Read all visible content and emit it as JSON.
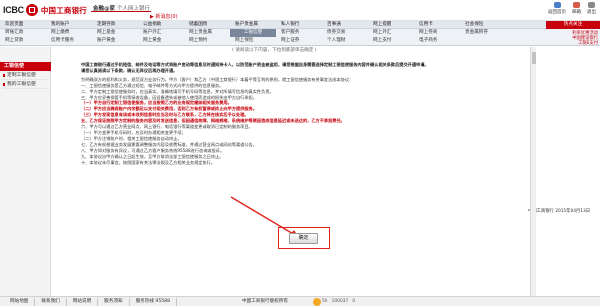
{
  "header": {
    "logo_en": "ICBC",
    "logo_cn": "中国工商银行",
    "product": "金融@家",
    "sub": "个人网上银行",
    "new_msg": "▶ 新消息(0)",
    "top_links": [
      {
        "label": "返回首页",
        "color": "blue"
      },
      {
        "label": "邮箱",
        "color": "red"
      },
      {
        "label": "退出",
        "color": "gray"
      }
    ]
  },
  "nav": {
    "row1": [
      "欢迎页面",
      "我的账户",
      "定期存款",
      "公益捐助",
      "储蓄国债",
      "账户贵金属",
      "私人银行",
      "百事通",
      "网上提醒",
      "信用卡",
      "社会保险"
    ],
    "row2": [
      "转账汇款",
      "网上缴费",
      "网上基金",
      "账户外汇",
      "网上贵金属",
      "网上保险",
      "客户服务",
      "债券交易",
      "网上外汇",
      "网上券商",
      "贵金属积存"
    ],
    "row3": [
      "网上贷款",
      "信用卡服务",
      "账户黄金",
      "网上黄金",
      "网上预约",
      "工银信使",
      "网上证券",
      "个人理财",
      "网上支付",
      "电子商务",
      "网上预约"
    ],
    "active_row2_index": 0,
    "hot_label": "热点关注",
    "hot_lines": [
      "利率优惠活动",
      "中国建设银行",
      "工银E支付"
    ]
  },
  "sidebar": {
    "title": "工银信使",
    "items": [
      "定制工银信使",
      "我的工银信使"
    ]
  },
  "main": {
    "top_caption": "( 请阅读以下内容，下拉到底部单击确定 )",
    "paragraphs": [
      {
        "text": "中国工商银行通过手机短信、邮件及电话等方式将账户变动等信息及时通知持卡人，以防范账户资金被盗用，请您根据自身需要选择定制工银信使服务内容并确认相关条款后提交开通申请。",
        "style": "bold"
      },
      {
        "text": "请您认真阅读以下条款，确认无异议后再办理开通。",
        "style": "bold"
      },
      {
        "text": "为明确双方的权利和义务，规范双方业务行为，甲方（客户）和乙方（中国工商银行）本着平等互利的原则，就工银信使服务有关事宜达成本协议：",
        "style": ""
      },
      {
        "text": "一、工银信使服务是乙方通过短信、电子邮件等方式向甲方提供的信息服务。",
        "style": ""
      },
      {
        "text": "二、甲方定制工银信使服务时，应当真实、准确地填写手机号码等信息，并对所填写信息的真实性负责。",
        "style": ""
      },
      {
        "text": "三、甲方应妥善保管手机等接收设备，因设备遗失或被他人使用而造成的损失由甲方自行承担。",
        "style": ""
      },
      {
        "text": "（一）甲方自行定制工银信使服务，应当按照乙方的业务规定缴纳相关服务费用。",
        "style": "red"
      },
      {
        "text": "（二）甲方应当确保账户内余额足以支付相关费用，否则乙方有权暂停或终止向甲方提供服务。",
        "style": "red"
      },
      {
        "text": "（三）甲方发现信息有误或未收到信息时应当及时与乙方联系，乙方将在核实后予以处理。",
        "style": "red"
      },
      {
        "text": "五、乙方保证按照甲方定制的服务内容及时发送信息，但因通信故障、网络拥堵、系统维护等原因造成信息延迟或未送达的，乙方不承担责任。",
        "style": "red"
      },
      {
        "text": "六、甲方可以通过乙方营业网点、网上银行、电话银行等渠道变更或取消已定制的服务项目。",
        "style": ""
      },
      {
        "text": "（一）甲方变更手机号码时，应及时办理相关变更手续；",
        "style": ""
      },
      {
        "text": "（二）甲方注销账户时，相关工银信使服务自动终止。",
        "style": ""
      },
      {
        "text": "七、乙方有权根据业务发展需要调整服务内容及收费标准，并通过营业网点或网站等渠道公告。",
        "style": ""
      },
      {
        "text": "八、甲方如对服务有异议，可通过乙方客户服务热线95588进行咨询或投诉。",
        "style": ""
      },
      {
        "text": "九、本协议自甲方确认之日起生效，至甲方取消全部工银信使服务之日终止。",
        "style": ""
      },
      {
        "text": "十、本协议未尽事宜，按照国家有关法律法规及乙方相关业务规定执行。",
        "style": ""
      }
    ],
    "date": "中国工商银行 2015年04月13日",
    "confirm_label": "确定"
  },
  "footer": {
    "links": [
      "网站地图",
      "联系我们",
      "网站说明",
      "服务须知",
      "服务热线 95588"
    ],
    "copyright": "中国工商银行版权所有",
    "stats": [
      "5h",
      "100037",
      "0"
    ]
  },
  "colors": {
    "brand_red": "#c7000b",
    "nav_bg": "#eef1f5",
    "active_tab": "#7a8699",
    "highlight": "#e1251b"
  }
}
